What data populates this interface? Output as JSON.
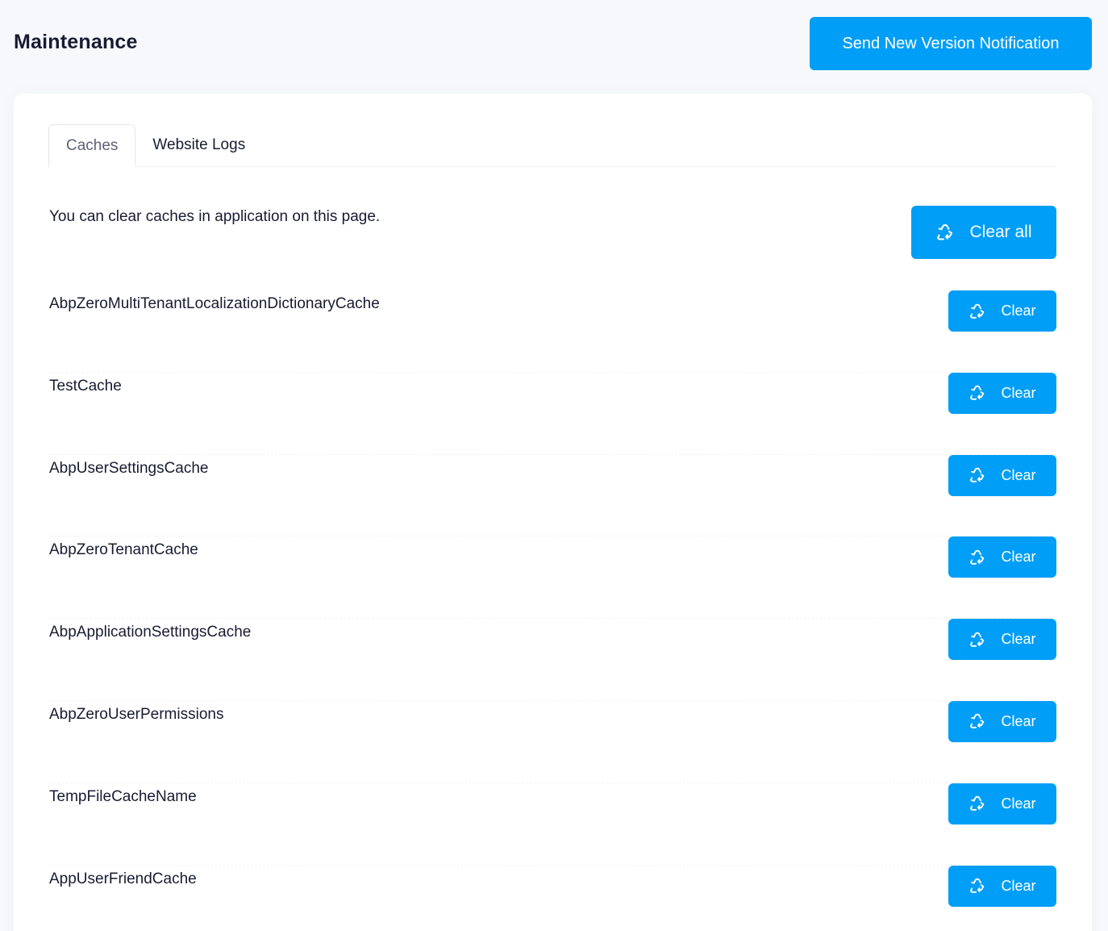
{
  "header": {
    "title": "Maintenance",
    "notify_button": "Send New Version Notification"
  },
  "tabs": [
    {
      "label": "Caches",
      "active": true
    },
    {
      "label": "Website Logs",
      "active": false
    }
  ],
  "caches": {
    "intro": "You can clear caches in application on this page.",
    "clear_all_label": "Clear all",
    "clear_label": "Clear",
    "icon": "recycle-icon",
    "items": [
      "AbpZeroMultiTenantLocalizationDictionaryCache",
      "TestCache",
      "AbpUserSettingsCache",
      "AbpZeroTenantCache",
      "AbpApplicationSettingsCache",
      "AbpZeroUserPermissions",
      "TempFileCacheName",
      "AppUserFriendCache"
    ]
  },
  "colors": {
    "primary": "#009ef7",
    "background": "#f6f8fb",
    "card": "#ffffff",
    "text": "#181c32"
  }
}
